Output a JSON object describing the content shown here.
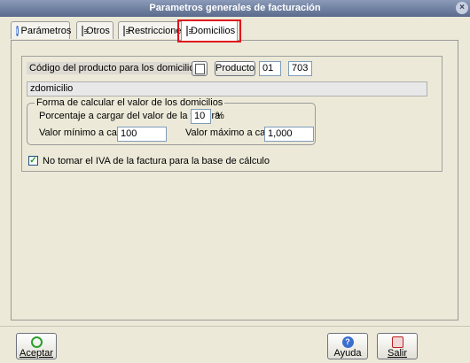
{
  "window": {
    "title": "Parametros generales de facturación",
    "close_glyph": "×"
  },
  "tabs": [
    {
      "label": "Parámetros",
      "icon": "info-icon",
      "active": false
    },
    {
      "label": "Otros",
      "icon": "document-icon",
      "active": false
    },
    {
      "label": "Restricciones",
      "icon": "document-icon",
      "active": false
    },
    {
      "label": "Domicilios",
      "icon": "document-icon",
      "active": true
    }
  ],
  "domicilios": {
    "product_code_label": "Código del producto para los domicilios",
    "product_button": "Producto",
    "product_group": "01",
    "product_code": "703",
    "product_name": "zdomicilio",
    "calc_group_title": "Forma de calcular el valor de los domicilios",
    "percent_label": "Porcentaje a cargar del valor de la factura",
    "percent_value": "10",
    "percent_unit": "%",
    "min_label": "Valor mínimo a cargar",
    "min_value": "100",
    "max_label": "Valor máximo a cargar",
    "max_value": "1,000",
    "iva_checkbox_label": "No tomar el IVA de la factura para la base de cálculo",
    "iva_checked": true
  },
  "footer": {
    "accept_label": "Aceptar",
    "help_label": "Ayuda",
    "exit_label": "Salir"
  },
  "colors": {
    "highlight": "#e0141c",
    "accept_icon": "#2aa02a",
    "help_icon": "#3a6fd0",
    "exit_icon": "#c02020"
  }
}
